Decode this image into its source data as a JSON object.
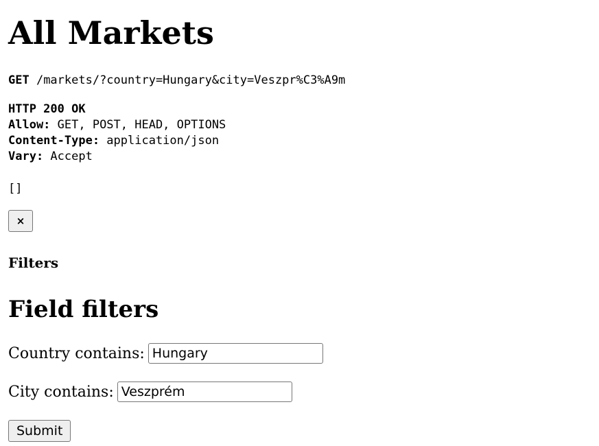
{
  "page": {
    "title": "All Markets"
  },
  "request": {
    "method": "GET",
    "path": " /markets/?country=Hungary&city=Veszpr%C3%A9m"
  },
  "response": {
    "status": "HTTP 200 OK",
    "headers": [
      {
        "name": "Allow:",
        "value": " GET, POST, HEAD, OPTIONS"
      },
      {
        "name": "Content-Type:",
        "value": " application/json"
      },
      {
        "name": "Vary:",
        "value": " Accept"
      }
    ],
    "body": "[]"
  },
  "close_button": {
    "label": "×"
  },
  "filters": {
    "heading": "Filters",
    "field_filters_heading": "Field filters",
    "country_label": "Country contains:",
    "country_value": "Hungary",
    "city_label": "City contains:",
    "city_value": "Veszprém",
    "submit_label": "Submit"
  }
}
